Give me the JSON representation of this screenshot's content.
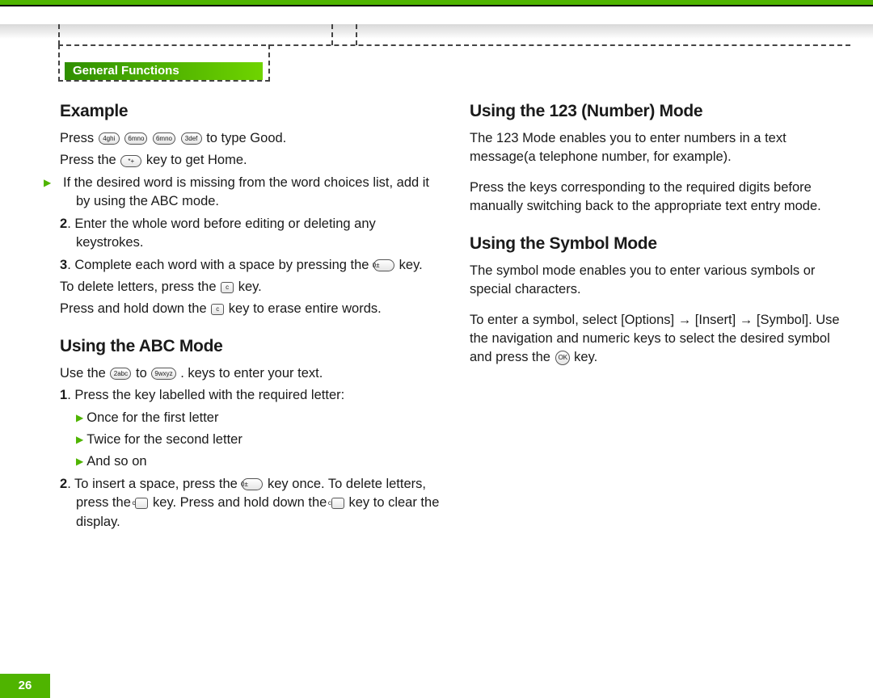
{
  "section_tab": "General Functions",
  "page_number": "26",
  "left": {
    "h_example": "Example",
    "press": "Press",
    "key_4": "4ghi",
    "key_6a": "6mno",
    "key_6b": "6mno",
    "key_3": "3def",
    "to_type_good": " to type Good.",
    "press_the": "Press the ",
    "key_star": "*+",
    "to_get_home": " key to get Home.",
    "b1": "If the desired word is missing from the word choices list, add it by using the ABC mode.",
    "n2a": "2",
    "n2b": ". Enter the whole word before editing or deleting any keystrokes.",
    "n3a": "3",
    "n3b": ". Complete each word with a space by pressing the ",
    "key_0a": "0±",
    "n3c": " key.",
    "del1a": "To delete letters, press the ",
    "key_c1": "c",
    "del1b": " key.",
    "del2a": "Press and hold down the ",
    "key_c2": "c",
    "del2b": " key to erase entire words.",
    "h_abc": "Using the ABC Mode",
    "use_a": "Use the ",
    "key_2": "2abc",
    "use_b": " to ",
    "key_9": "9wxyz",
    "use_c": " . keys to enter your text.",
    "abc1a": "1",
    "abc1b": ". Press the key labelled with the required letter:",
    "abc_b1": "Once for the first letter",
    "abc_b2": "Twice for the second letter",
    "abc_b3": "And so on",
    "abc2a": "2",
    "abc2b": ". To insert a space, press the ",
    "key_0b": "0±",
    "abc2c": " key once. To delete letters, press the ",
    "key_c3": "c",
    "abc2d": " key. Press and hold down the ",
    "key_c4": "c",
    "abc2e": " key to clear the display."
  },
  "right": {
    "h_123": "Using the 123 (Number) Mode",
    "p123a": "The 123 Mode enables you to enter numbers in a text message(a telephone number, for example).",
    "p123b": "Press the keys corresponding to the required digits before manually switching back to the appropriate text entry mode.",
    "h_sym": "Using the Symbol Mode",
    "psym1": "The symbol mode enables you to enter various symbols or special characters.",
    "psym2a": "To enter a symbol, select [Options] → [Insert] → [Symbol]. Use the navigation and numeric keys to select the desired symbol and press the ",
    "key_ok": "OK",
    "psym2b": " key."
  }
}
